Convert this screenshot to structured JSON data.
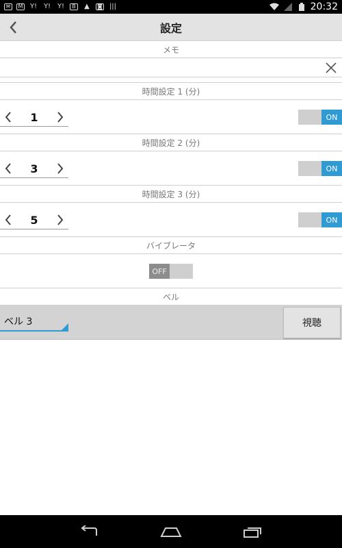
{
  "status_bar": {
    "time": "20:32",
    "icons": [
      "mail-icon",
      "gmail-icon",
      "yahoo-icon",
      "yahoo-icon",
      "yahoo-icon",
      "b-icon",
      "warning-icon",
      "bag-icon",
      "barcode-icon"
    ],
    "right_icons": [
      "wifi-icon",
      "signal-icon",
      "battery-icon"
    ]
  },
  "app_bar": {
    "title": "設定",
    "back_icon": "chevron-left-icon"
  },
  "memo": {
    "label": "メモ",
    "value": "",
    "placeholder": "",
    "clear_icon": "close-icon"
  },
  "timers": [
    {
      "label": "時間設定 1 (分)",
      "value": "1",
      "toggle": "ON"
    },
    {
      "label": "時間設定 2 (分)",
      "value": "3",
      "toggle": "ON"
    },
    {
      "label": "時間設定 3 (分)",
      "value": "5",
      "toggle": "ON"
    }
  ],
  "vibrator": {
    "label": "バイブレータ",
    "toggle": "OFF"
  },
  "bell": {
    "label": "ベル",
    "selected": "ベル 3",
    "listen_button": "視聴"
  },
  "colors": {
    "accent": "#2f9bd2",
    "toggle_track": "#cfcfcf",
    "toggle_off_knob": "#8d8d8d",
    "app_bar": "#e3e3e3"
  },
  "nav_bar": {
    "icons": [
      "back-icon",
      "home-icon",
      "recent-apps-icon"
    ]
  }
}
